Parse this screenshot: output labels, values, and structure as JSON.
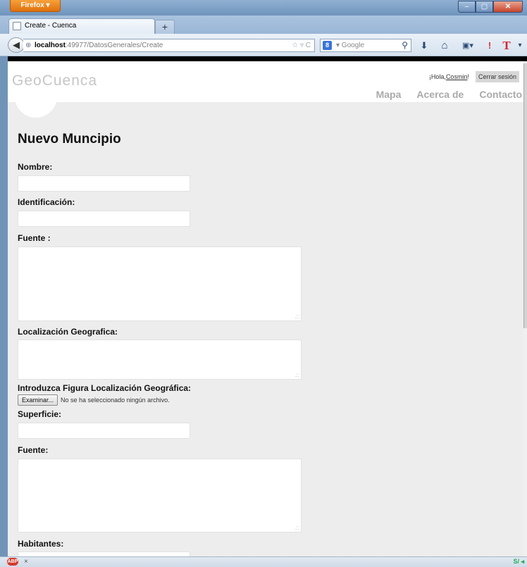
{
  "browser": {
    "menu_button": "Firefox ▾",
    "window_controls": {
      "minimize": "–",
      "maximize": "▢",
      "close": "✕"
    },
    "tab": {
      "title": "Create - Cuenca"
    },
    "new_tab": "+",
    "url": {
      "host": "localhost",
      "path": ":49977/DatosGenerales/Create",
      "icons": "☆ ▿ C"
    },
    "search": {
      "engine_letter": "8",
      "placeholder": "▾ Google",
      "go_icon": "magnifier-icon"
    },
    "toolbar_icons": [
      "download-icon",
      "home-icon",
      "bookmarks-icon",
      "alert-icon",
      "text-icon"
    ],
    "toolbar_glyphs": {
      "download": "⬇",
      "home": "⌂",
      "bookmarks": "▣▾",
      "alert": "!",
      "text": "T",
      "more": "▾"
    },
    "status": {
      "addon": "ABP",
      "close": "×",
      "right": "S/ ◂"
    }
  },
  "site": {
    "title": "GeoCuenca",
    "greeting_prefix": "¡Hola, ",
    "greeting_user": "Cosmin",
    "greeting_suffix": "!",
    "logout": "Cerrar sesión",
    "nav": [
      "Mapa",
      "Acerca de",
      "Contacto"
    ]
  },
  "form": {
    "title": "Nuevo Muncipio",
    "fields": {
      "nombre": {
        "label": "Nombre:",
        "value": ""
      },
      "identificacion": {
        "label": "Identificación:",
        "value": ""
      },
      "fuente1": {
        "label": "Fuente :",
        "value": ""
      },
      "localizacion": {
        "label": "Localización Geografica:",
        "value": ""
      },
      "figura": {
        "label": "Introduzca Figura Localización Geográfica:",
        "button": "Examinar...",
        "status": "No se ha seleccionado ningún archivo."
      },
      "superficie": {
        "label": "Superficie:",
        "value": ""
      },
      "fuente2": {
        "label": "Fuente:",
        "value": ""
      },
      "habitantes": {
        "label": "Habitantes:",
        "value": ""
      }
    }
  },
  "colors": {
    "accent_orange": "#e0700c",
    "chrome_blue": "#6f94b8",
    "page_bg": "#ededed"
  }
}
